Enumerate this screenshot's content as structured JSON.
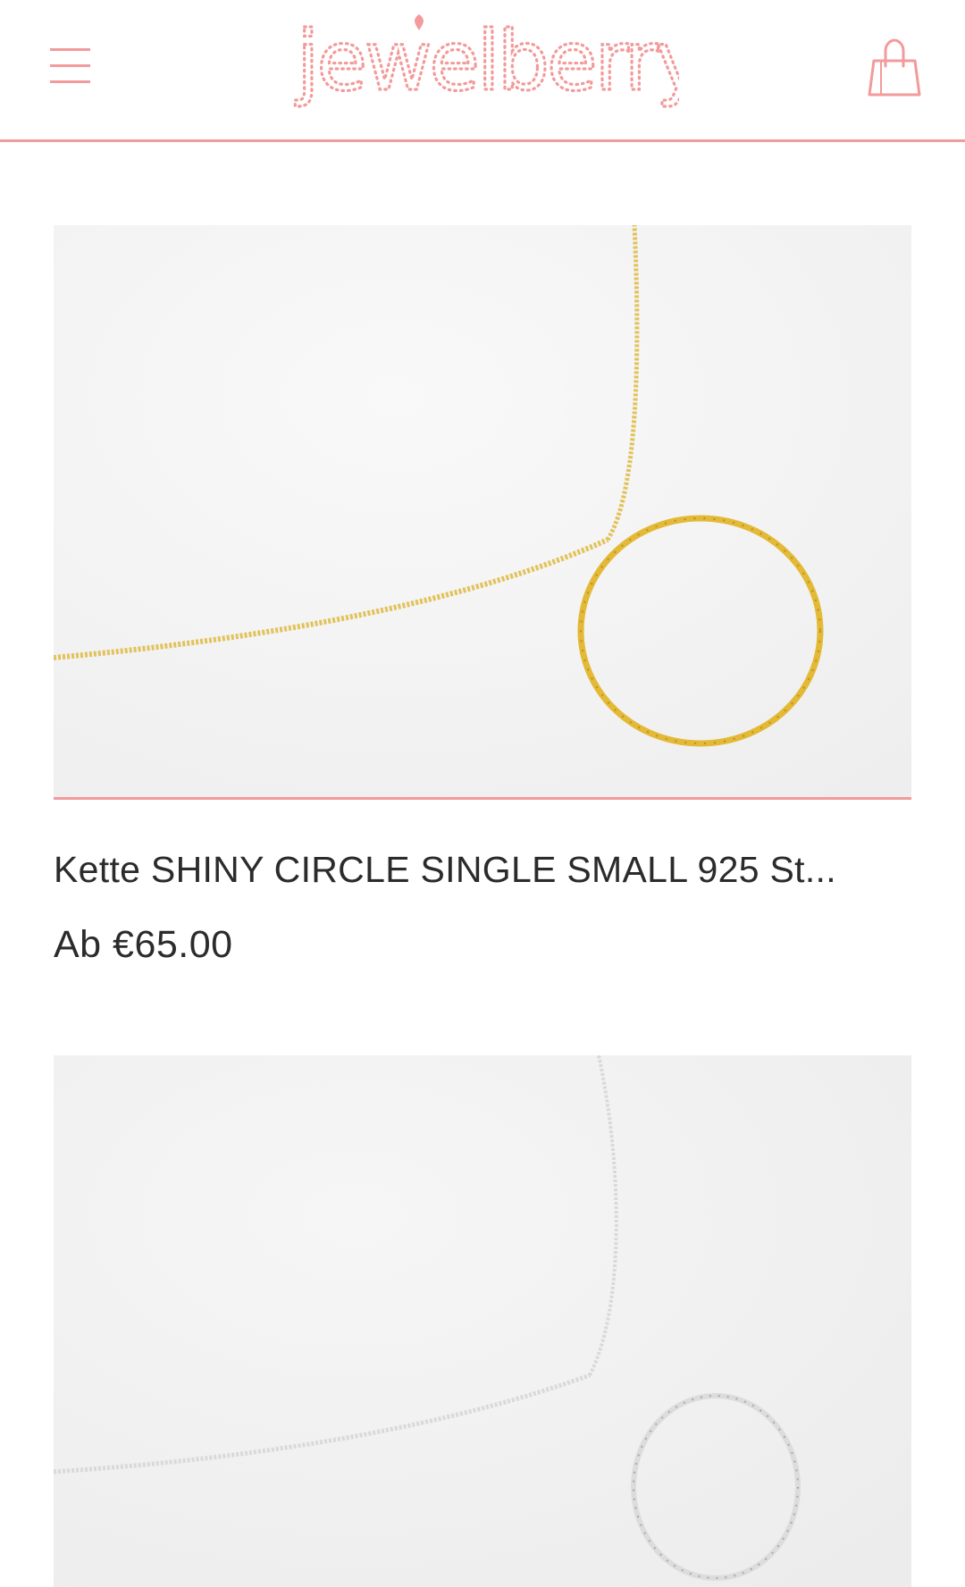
{
  "header": {
    "brand_name": "jewelberry",
    "menu_icon": "hamburger-menu-icon",
    "cart_icon": "shopping-bag-icon",
    "accent_color": "#f39a9a"
  },
  "products": [
    {
      "title": "Kette SHINY CIRCLE SINGLE SMALL 925 St...",
      "price": "Ab €65.00",
      "image": "gold-circle-necklace"
    },
    {
      "image": "silver-circle-necklace"
    }
  ]
}
